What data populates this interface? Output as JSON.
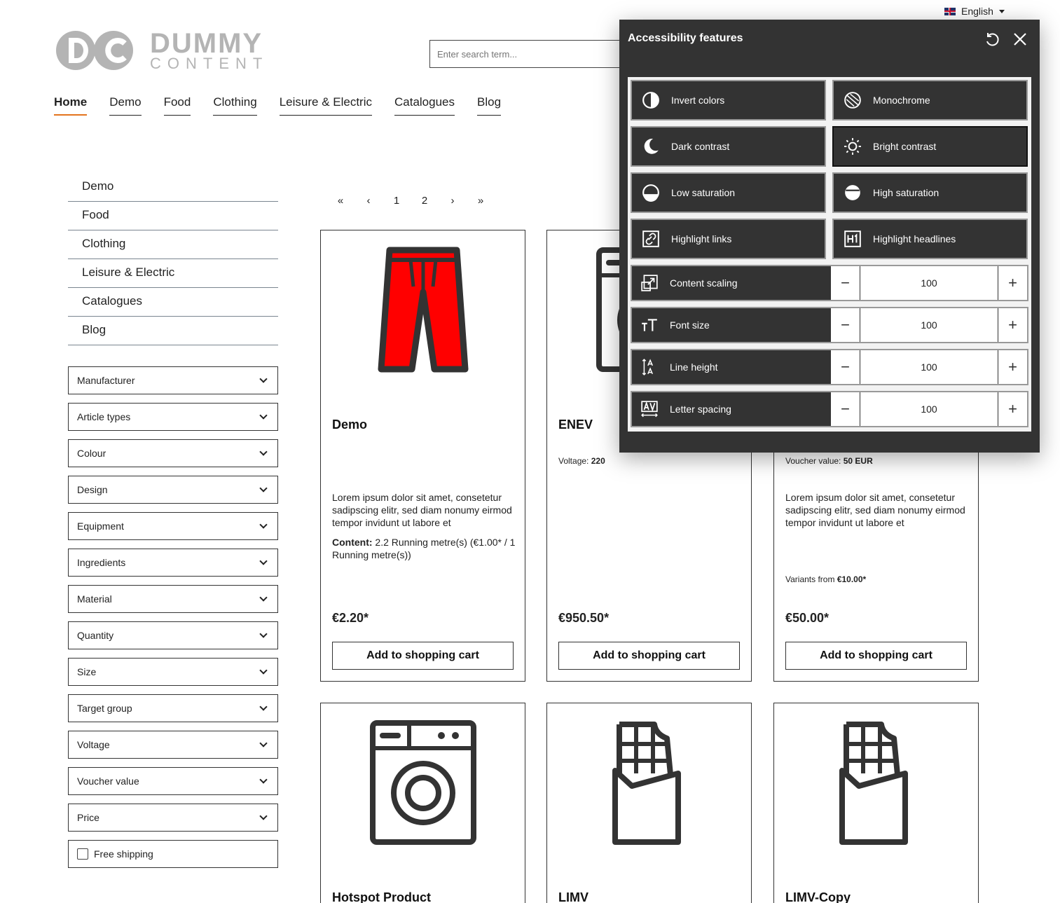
{
  "language": {
    "label": "English",
    "icon": "uk-flag-icon"
  },
  "logo": {
    "word1": "DUMMY",
    "word2": "CONTENT",
    "color": "#b4b4b4"
  },
  "search": {
    "placeholder": "Enter search term..."
  },
  "main_nav": [
    "Home",
    "Demo",
    "Food",
    "Clothing",
    "Leisure & Electric",
    "Catalogues",
    "Blog"
  ],
  "accent_color": "#e3741e",
  "sidebar": {
    "categories": [
      "Demo",
      "Food",
      "Clothing",
      "Leisure & Electric",
      "Catalogues",
      "Blog"
    ],
    "filters": [
      "Manufacturer",
      "Article types",
      "Colour",
      "Design",
      "Equipment",
      "Ingredients",
      "Material",
      "Quantity",
      "Size",
      "Target group",
      "Voltage",
      "Voucher value",
      "Price"
    ],
    "free_shipping": "Free shipping"
  },
  "pager": {
    "first": "«",
    "prev": "‹",
    "pages": [
      "1",
      "2"
    ],
    "next": "›",
    "last": "»"
  },
  "products": [
    {
      "name": "Demo",
      "icon": "trousers-icon",
      "description": "Lorem ipsum dolor sit amet, consetetur sadipscing elitr, sed diam nonumy eirmod tempor invidunt ut labore et",
      "content_label": "Content:",
      "content_value": " 2.2 Running metre(s) (€1.00* / 1 Running metre(s))",
      "price": "€2.20*",
      "button": "Add to shopping cart"
    },
    {
      "name": "ENEV",
      "icon": "washing-machine-icon",
      "prop_label": "Voltage: ",
      "prop_value": "220",
      "price": "€950.50*",
      "button": "Add to shopping cart"
    },
    {
      "name": "",
      "icon": "",
      "prop_label": "Voucher value: ",
      "prop_value": "50 EUR",
      "description": "Lorem ipsum dolor sit amet, consetetur sadipscing elitr, sed diam nonumy eirmod tempor invidunt ut labore et",
      "variants_label": "Variants from ",
      "variants_value": "€10.00*",
      "price": "€50.00*",
      "button": "Add to shopping cart"
    },
    {
      "name": "Hotspot Product",
      "icon": "washing-machine-icon"
    },
    {
      "name": "LIMV",
      "icon": "chocolate-bar-icon"
    },
    {
      "name": "LIMV-Copy",
      "icon": "chocolate-bar-icon"
    }
  ],
  "a11y": {
    "title": "Accessibility features",
    "tiles": [
      {
        "label": "Invert colors",
        "icon": "invert-colors-icon"
      },
      {
        "label": "Monochrome",
        "icon": "monochrome-icon"
      },
      {
        "label": "Dark contrast",
        "icon": "moon-icon"
      },
      {
        "label": "Bright contrast",
        "icon": "sun-icon"
      },
      {
        "label": "Low saturation",
        "icon": "low-saturation-icon"
      },
      {
        "label": "High saturation",
        "icon": "high-saturation-icon"
      },
      {
        "label": "Highlight links",
        "icon": "link-icon"
      },
      {
        "label": "Highlight headlines",
        "icon": "h1-icon"
      }
    ],
    "steppers": [
      {
        "label": "Content scaling",
        "value": "100",
        "icon": "scaling-icon"
      },
      {
        "label": "Font size",
        "value": "100",
        "icon": "font-size-icon"
      },
      {
        "label": "Line height",
        "value": "100",
        "icon": "line-height-icon"
      },
      {
        "label": "Letter spacing",
        "value": "100",
        "icon": "letter-spacing-icon"
      }
    ],
    "minus": "−",
    "plus": "+"
  }
}
